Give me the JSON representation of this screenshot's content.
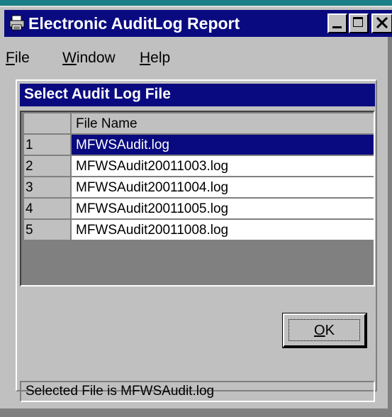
{
  "window": {
    "title": "Electronic AuditLog Report",
    "app_icon": "printer-icon",
    "controls": [
      "minimize-icon",
      "maximize-icon",
      "close-icon"
    ]
  },
  "menu": {
    "items": [
      {
        "accel": "F",
        "rest": "ile"
      },
      {
        "accel": "W",
        "rest": "indow"
      },
      {
        "accel": "H",
        "rest": "elp"
      }
    ]
  },
  "panel": {
    "title": "Select Audit Log File"
  },
  "grid": {
    "header": "File Name",
    "rows": [
      {
        "num": "1",
        "name": "MFWSAudit.log"
      },
      {
        "num": "2",
        "name": "MFWSAudit20011003.log"
      },
      {
        "num": "3",
        "name": "MFWSAudit20011004.log"
      },
      {
        "num": "4",
        "name": "MFWSAudit20011005.log"
      },
      {
        "num": "5",
        "name": "MFWSAudit20011008.log"
      }
    ]
  },
  "ok_button": {
    "accel": "O",
    "rest": "K"
  },
  "status": {
    "text": "Selected File is MFWSAudit.log"
  },
  "colors": {
    "titlebar": "#0a0a80",
    "selection": "#0a0a80",
    "face": "#c0c0c0"
  }
}
